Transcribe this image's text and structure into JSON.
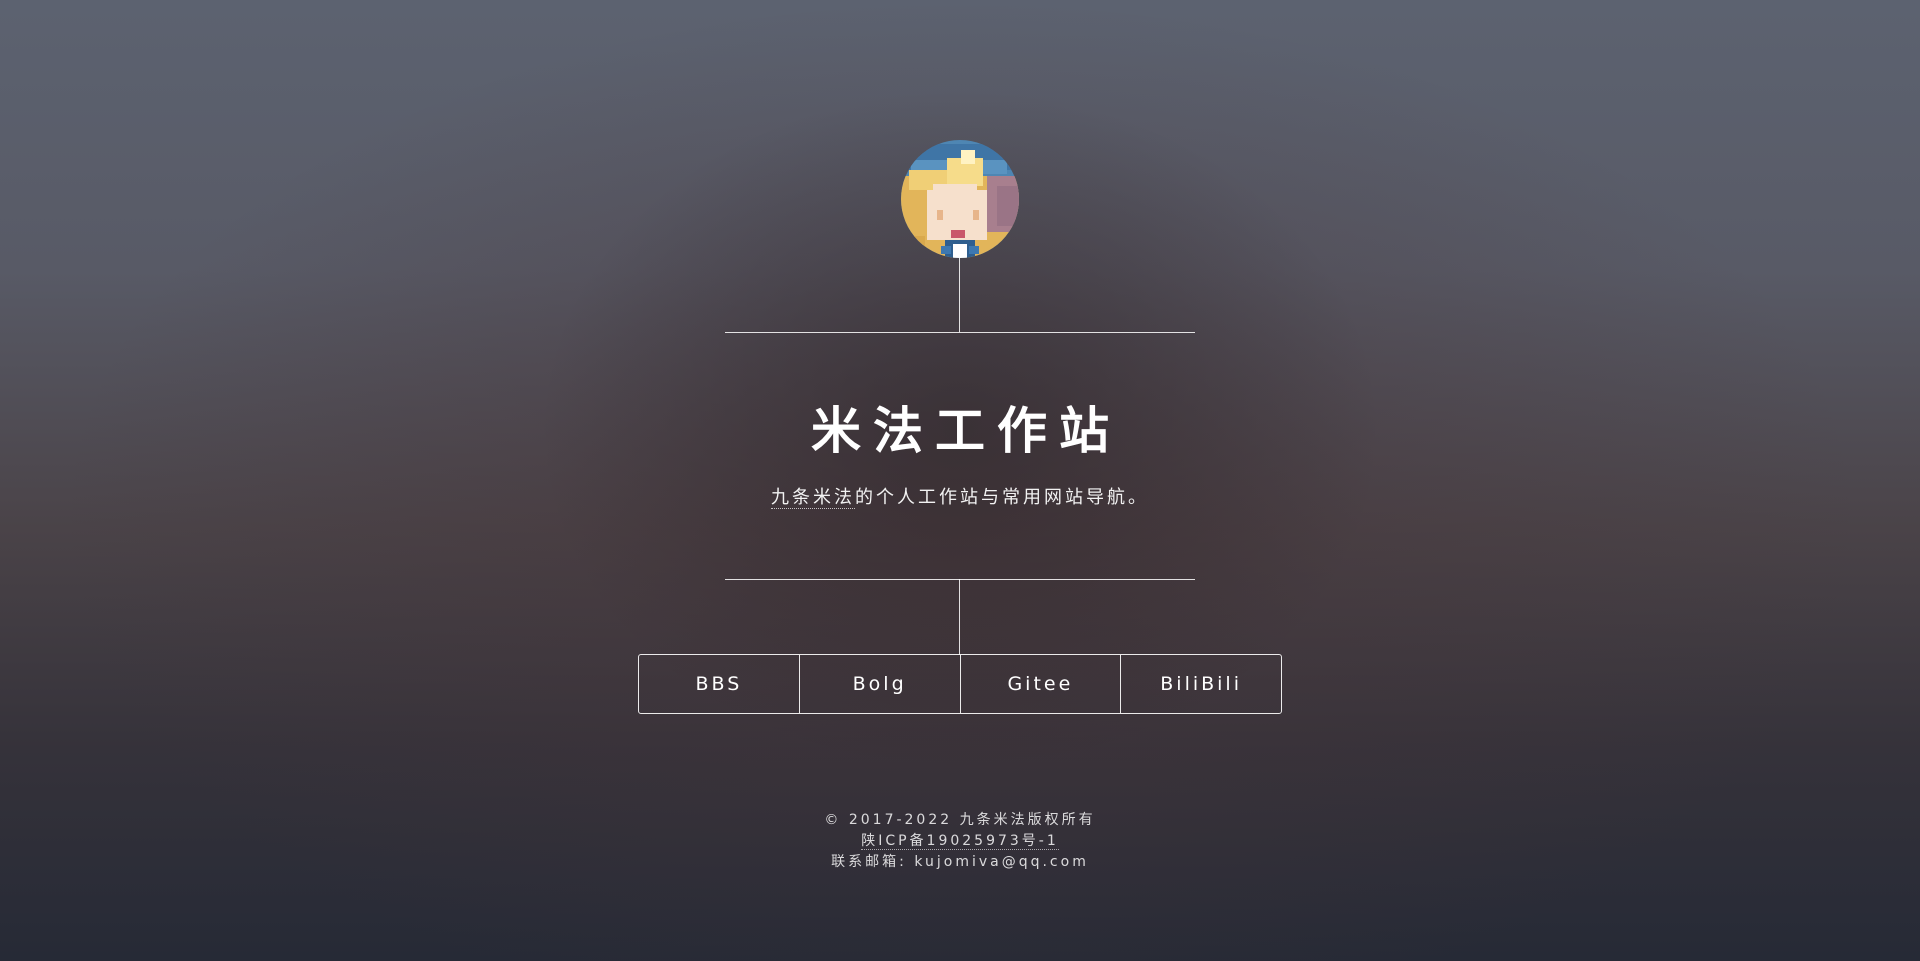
{
  "site": {
    "title": "米法工作站",
    "subtitle_link": "九条米法",
    "subtitle_rest": "的个人工作站与常用网站导航。"
  },
  "avatar": {
    "icon": "pixel-anime-avatar"
  },
  "nav": {
    "items": [
      {
        "label": "BBS"
      },
      {
        "label": "Bolg"
      },
      {
        "label": "Gitee"
      },
      {
        "label": "BiliBili"
      }
    ]
  },
  "footer": {
    "copyright": "© 2017-2022 九条米法版权所有",
    "icp": "陕ICP备19025973号-1",
    "email_label": "联系邮箱: ",
    "email": "kujomiva@qq.com"
  }
}
